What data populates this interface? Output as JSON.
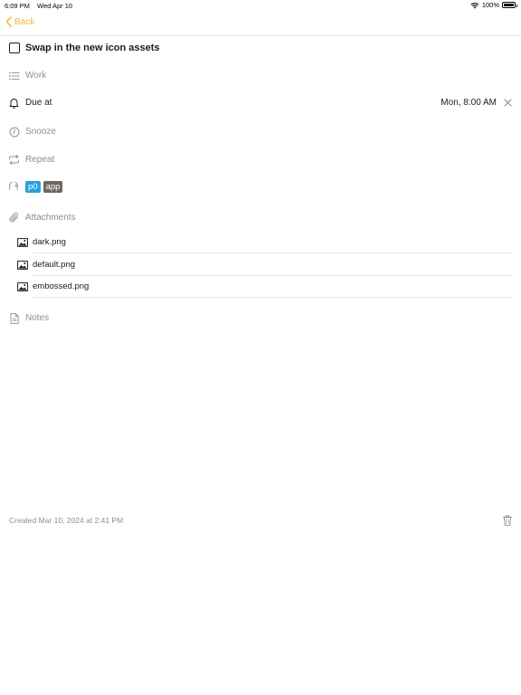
{
  "status_bar": {
    "time": "6:09 PM",
    "date": "Wed Apr 10",
    "battery": "100%"
  },
  "nav": {
    "back_label": "Back"
  },
  "task": {
    "title": "Swap in the new icon assets"
  },
  "list": {
    "label": "Work"
  },
  "due": {
    "label": "Due at",
    "value": "Mon, 8:00 AM"
  },
  "snooze": {
    "label": "Snooze"
  },
  "repeat": {
    "label": "Repeat"
  },
  "tags": [
    {
      "label": "p0",
      "color": "#2a9fdc"
    },
    {
      "label": "app",
      "color": "#6e6660"
    }
  ],
  "attachments": {
    "label": "Attachments",
    "items": [
      {
        "name": "dark.png"
      },
      {
        "name": "default.png"
      },
      {
        "name": "embossed.png"
      }
    ]
  },
  "notes": {
    "label": "Notes"
  },
  "footer": {
    "created": "Created Mar 10, 2024 at 2:41 PM"
  },
  "colors": {
    "accent": "#f2b92c",
    "muted": "#8e8e93"
  }
}
